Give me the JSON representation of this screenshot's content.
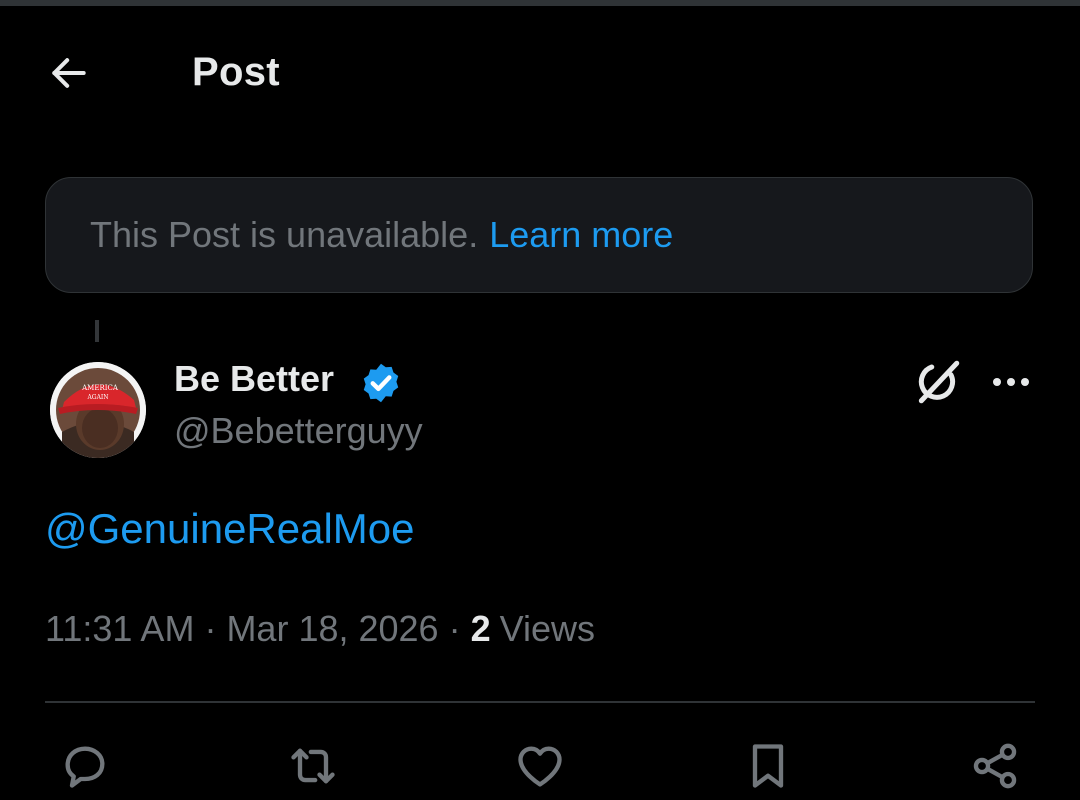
{
  "header": {
    "back_icon": "arrow-left-icon",
    "title": "Post"
  },
  "notice": {
    "text": "This Post is unavailable.",
    "link": "Learn more"
  },
  "post": {
    "author": {
      "display_name": "Be Better",
      "handle": "@Bebetterguyy",
      "verified": true,
      "avatar_icon": "avatar-red-cap-icon"
    },
    "mention": "@GenuineRealMoe",
    "time": "11:31 AM",
    "date": "Mar 18, 2026",
    "separator": "·",
    "views_count": "2",
    "views_label": "Views"
  },
  "actions": [
    {
      "name": "reply",
      "icon": "speech-bubble-icon"
    },
    {
      "name": "repost",
      "icon": "repost-arrows-icon"
    },
    {
      "name": "like",
      "icon": "heart-icon"
    },
    {
      "name": "bookmark",
      "icon": "bookmark-icon"
    },
    {
      "name": "share",
      "icon": "share-nodes-icon"
    }
  ],
  "colors": {
    "background": "#000000",
    "text_primary": "#e7e9ea",
    "text_secondary": "#71767b",
    "accent": "#1d9bf0",
    "border": "#2f3336",
    "notice_bg": "#16181c"
  }
}
